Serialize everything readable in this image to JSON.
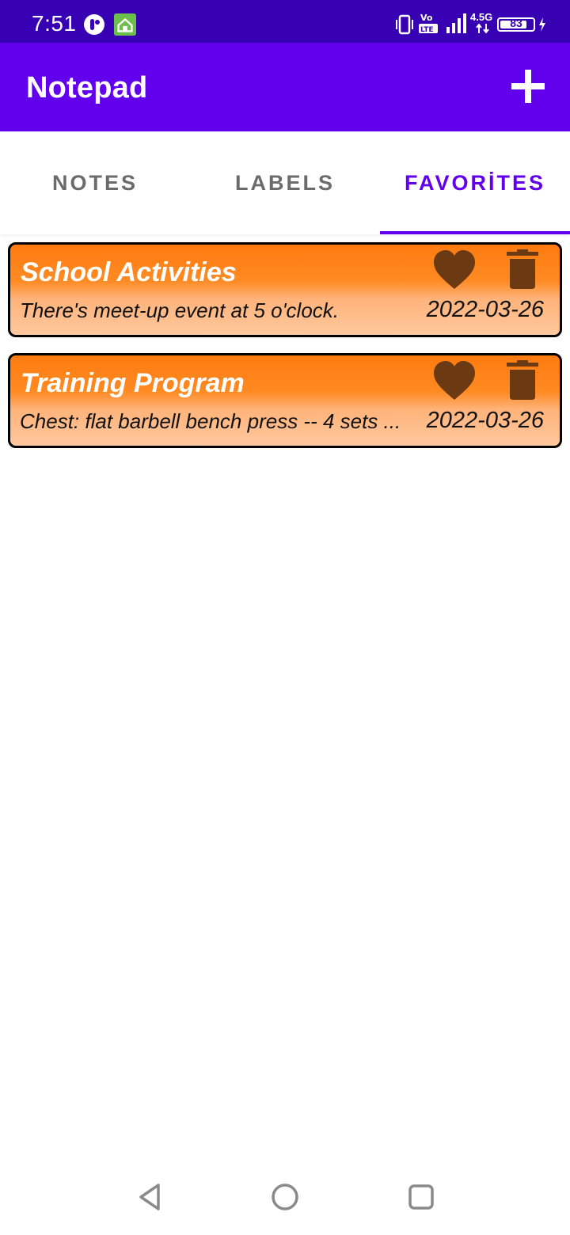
{
  "status_bar": {
    "time": "7:51",
    "network": "4.5G",
    "volte": "Vo LTE",
    "battery": "83",
    "battery_fraction": 0.83
  },
  "app_bar": {
    "title": "Notepad",
    "add_icon": "plus-icon"
  },
  "tabs": [
    {
      "label": "NOTES",
      "active": false
    },
    {
      "label": "LABELS",
      "active": false
    },
    {
      "label": "FAVORİTES",
      "active": true
    }
  ],
  "notes": [
    {
      "title": "School Activities",
      "body": "There's meet-up event at 5 o'clock.",
      "date": "2022-03-26",
      "favorite_icon": "heart-icon",
      "delete_icon": "trash-icon"
    },
    {
      "title": "Training Program",
      "body": "Chest: flat barbell bench press -- 4 sets ...",
      "date": "2022-03-26",
      "favorite_icon": "heart-icon",
      "delete_icon": "trash-icon"
    }
  ],
  "colors": {
    "status_bar": "#3700b3",
    "primary": "#6200ee",
    "card_orange": "#ff7b10",
    "card_light": "#ffc89e",
    "icon_brown": "#6b3a12"
  },
  "nav_bar": {
    "back_icon": "back-triangle-icon",
    "home_icon": "home-circle-icon",
    "recents_icon": "recents-square-icon"
  }
}
